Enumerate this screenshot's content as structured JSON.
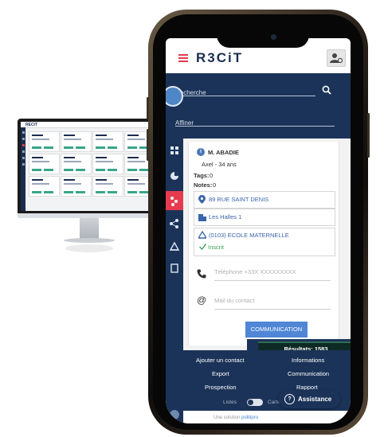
{
  "monitor": {
    "logo": "RECIT"
  },
  "app": {
    "logo": "R3CiT",
    "menu_icon": "hamburger-icon",
    "profile_icon": "user-gear-icon",
    "brand_accent": "#e63b4f",
    "navy": "#1b3358"
  },
  "search": {
    "label": "Recherche",
    "refine_label": "Affiner",
    "icon": "search-icon"
  },
  "contact": {
    "name": "M.  ABADIE",
    "subtitle": "Axel - 34 ans",
    "tags_label": "Tags:",
    "tags_count": "0",
    "notes_label": "Notes:",
    "notes_count": "0",
    "address": "89 RUE SAINT DENIS",
    "district": "Les Halles 1",
    "school": "(0103) ECOLE MATERNELLE",
    "status": "Inscrit",
    "phone_placeholder": "Téléphone +33X XXXXXXXXX",
    "email_placeholder": "Mail du contact",
    "communication_button": "COMMUNICATION",
    "results_label": "Résultats: 1583"
  },
  "bottom_menu": {
    "left": [
      "Ajouter un contact",
      "Export",
      "Prospection"
    ],
    "right": [
      "Informations",
      "Communication",
      "Rapport"
    ],
    "toggle_left": "Listes",
    "toggle_right": "Cartes"
  },
  "footer": {
    "solution_text": "Une solution",
    "brand": "politipro"
  },
  "assistance": {
    "label": "Assistance",
    "icon": "?"
  }
}
